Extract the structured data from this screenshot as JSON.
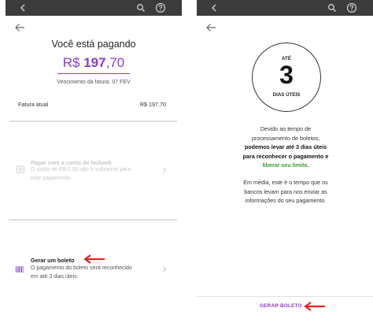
{
  "colors": {
    "accent": "#8a3cc4",
    "topbar": "#3c3c3c",
    "green": "#3d9b35",
    "annotation_arrow": "#d62b1f"
  },
  "left": {
    "title": "Você está pagando",
    "amount": {
      "currency": "R$",
      "integer": "197",
      "decimal": ",70"
    },
    "due_label": "Vencimento da fatura: 07 FEV",
    "fatura": {
      "label": "Fatura atual",
      "value": "R$ 197,70"
    },
    "options": [
      {
        "title": "Pagar com a conta do Nubank",
        "desc_lines": [
          "O saldo de R$ 0,00 não é suficiente para",
          "este pagamento."
        ],
        "icon": "nubank-account-icon",
        "enabled": false
      },
      {
        "title": "Gerar um boleto",
        "desc_lines": [
          "O pagamento do boleto será reconhecido",
          "em até 3 dias úteis."
        ],
        "icon": "barcode-icon",
        "enabled": true
      }
    ]
  },
  "right": {
    "circle": {
      "top": "ATÉ",
      "number": "3",
      "bottom": "DIAS ÚTEIS"
    },
    "paragraph1": {
      "l1": "Devido ao tempo de",
      "l2": "processamento de boletos,",
      "l3": "podemos levar até 3 dias úteis",
      "l4": "para reconhecer o pagamento e",
      "l5": "liberar seu limite",
      "l5_tail": "."
    },
    "paragraph2": {
      "l1": "Em média, este é o tempo que os",
      "l2": "bancos levam para nos enviar as",
      "l3": "informações do seu pagamento."
    },
    "button": "GERAR BOLETO"
  }
}
